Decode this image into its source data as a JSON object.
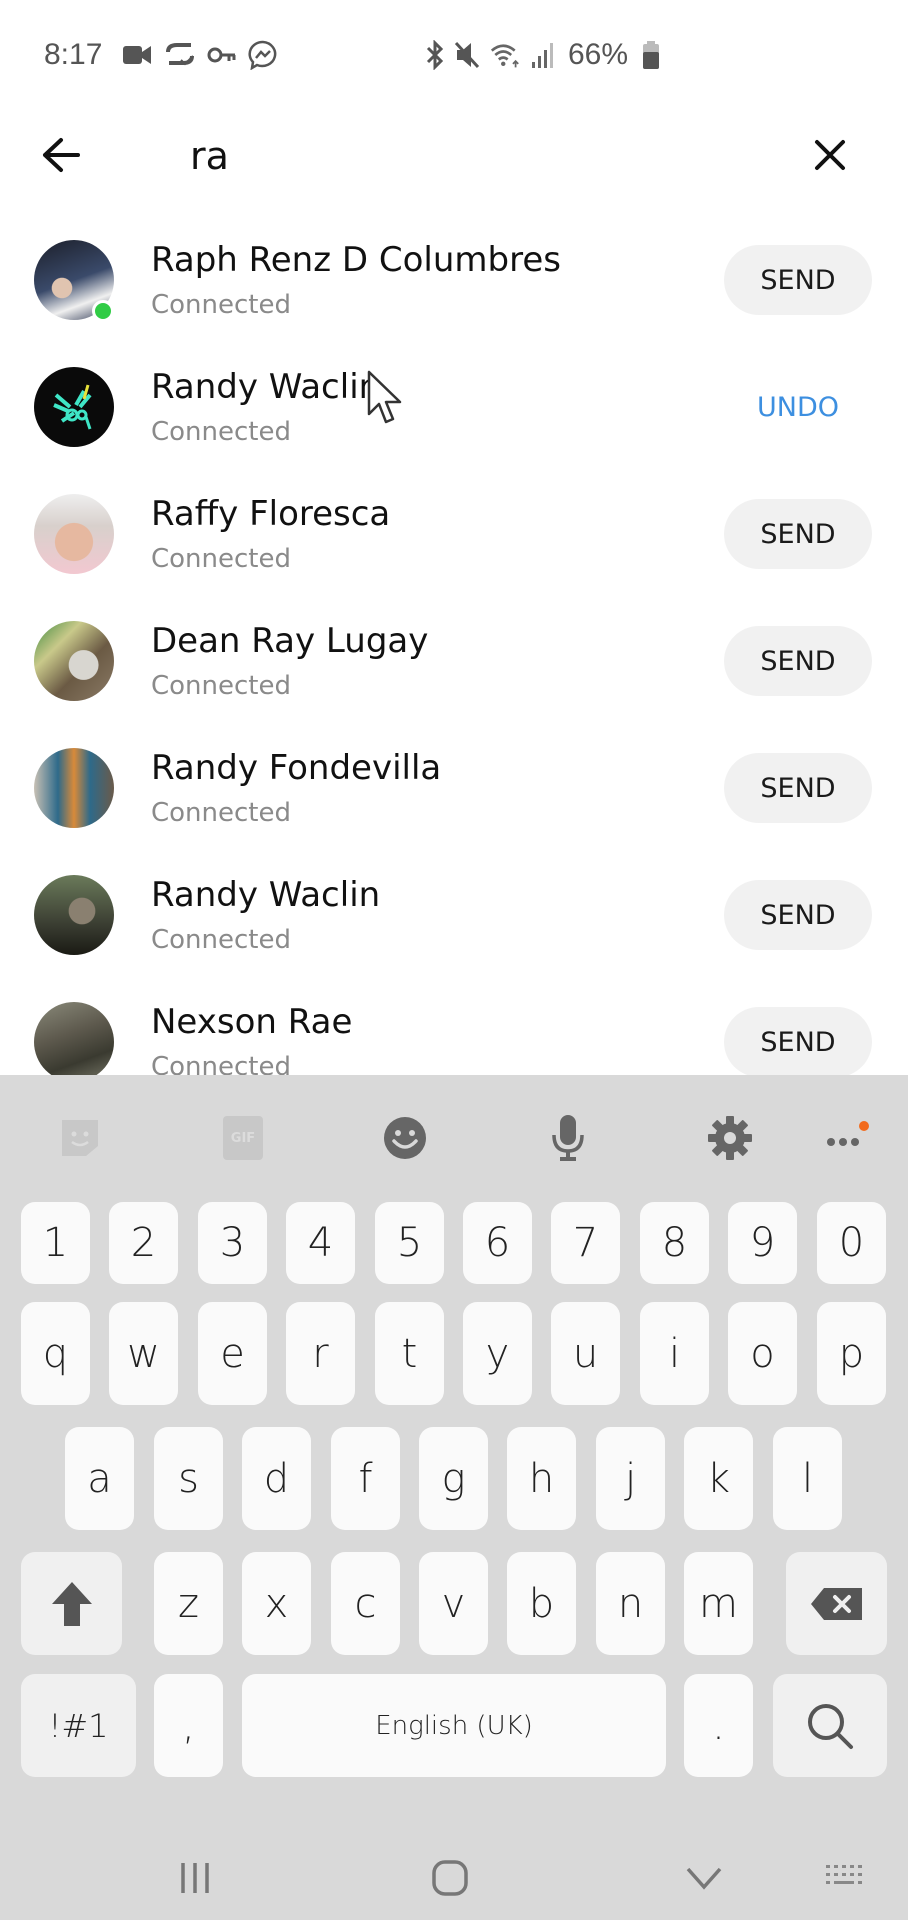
{
  "status_bar": {
    "time": "8:17",
    "left_icons": [
      "video-call-icon",
      "sync-icon",
      "vpn-key-icon",
      "messenger-icon"
    ],
    "right_icons": [
      "bluetooth-icon",
      "mute-icon",
      "wifi-icon",
      "signal-icon"
    ],
    "battery": "66%"
  },
  "search": {
    "value": "ra",
    "back_icon": "arrow-left-icon",
    "clear_icon": "close-icon"
  },
  "results": [
    {
      "name": "Raph Renz D Columbres",
      "status": "Connected",
      "action": "SEND",
      "online": true,
      "avatar_color": "#3a4a6a"
    },
    {
      "name": "Randy Waclin",
      "status": "Connected",
      "action": "UNDO",
      "online": false,
      "avatar_color": "#0a0a0a"
    },
    {
      "name": "Raffy Floresca",
      "status": "Connected",
      "action": "SEND",
      "online": false,
      "avatar_color": "#c9a79a"
    },
    {
      "name": "Dean Ray Lugay",
      "status": "Connected",
      "action": "SEND",
      "online": false,
      "avatar_color": "#7d8a6a"
    },
    {
      "name": "Randy Fondevilla",
      "status": "Connected",
      "action": "SEND",
      "online": false,
      "avatar_color": "#5a6e7a"
    },
    {
      "name": "Randy Waclin",
      "status": "Connected",
      "action": "SEND",
      "online": false,
      "avatar_color": "#3c3f33"
    },
    {
      "name": "Nexson Rae",
      "status": "Connected",
      "action": "SEND",
      "online": false,
      "avatar_color": "#5e5a4e"
    }
  ],
  "colors": {
    "undo": "#3d8fe0",
    "online": "#31cc46",
    "keyboard_bg": "#d9d9d9",
    "notification_dot": "#f26b1d"
  },
  "keyboard": {
    "toolbar": [
      "sticker-icon",
      "gif-icon",
      "emoji-icon",
      "microphone-icon",
      "settings-icon",
      "more-icon"
    ],
    "gif_label": "GIF",
    "row_numbers": [
      "1",
      "2",
      "3",
      "4",
      "5",
      "6",
      "7",
      "8",
      "9",
      "0"
    ],
    "row1": [
      "q",
      "w",
      "e",
      "r",
      "t",
      "y",
      "u",
      "i",
      "o",
      "p"
    ],
    "row2": [
      "a",
      "s",
      "d",
      "f",
      "g",
      "h",
      "j",
      "k",
      "l"
    ],
    "row3": [
      "z",
      "x",
      "c",
      "v",
      "b",
      "n",
      "m"
    ],
    "symbols_label": "!#1",
    "comma": ",",
    "space_label": "English (UK)",
    "period": ".",
    "search_icon": "search-icon"
  },
  "navbar": [
    "recent-apps-icon",
    "home-icon",
    "hide-keyboard-icon",
    "keyboard-switch-icon"
  ]
}
